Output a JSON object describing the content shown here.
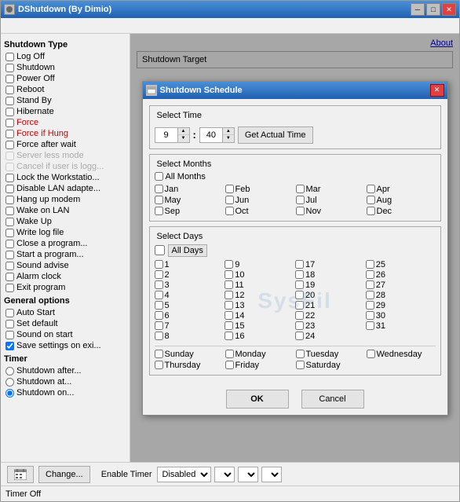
{
  "window": {
    "title": "DShutdown (By Dimio)",
    "icon": "app-icon",
    "minimize": "─",
    "maximize": "□",
    "close": "✕"
  },
  "menu": {
    "items": []
  },
  "left_panel": {
    "group_shutdown": "Shutdown Type",
    "items": [
      {
        "label": "Log Off",
        "checked": false,
        "disabled": false,
        "red": false
      },
      {
        "label": "Shutdown",
        "checked": false,
        "disabled": false,
        "red": false
      },
      {
        "label": "Power Off",
        "checked": false,
        "disabled": false,
        "red": false
      },
      {
        "label": "Reboot",
        "checked": false,
        "disabled": false,
        "red": false
      },
      {
        "label": "Stand By",
        "checked": false,
        "disabled": false,
        "red": false
      },
      {
        "label": "Hibernate",
        "checked": false,
        "disabled": false,
        "red": false
      },
      {
        "label": "Force",
        "checked": false,
        "disabled": false,
        "red": true
      },
      {
        "label": "Force if Hung",
        "checked": false,
        "disabled": false,
        "red": true
      },
      {
        "label": "Force after wait",
        "checked": false,
        "disabled": false,
        "red": false
      },
      {
        "label": "Server less mode",
        "checked": false,
        "disabled": true,
        "red": false
      },
      {
        "label": "Cancel if user is logg...",
        "checked": false,
        "disabled": true,
        "red": false
      },
      {
        "label": "Lock the Workstatio...",
        "checked": false,
        "disabled": false,
        "red": false
      },
      {
        "label": "Disable LAN adapte...",
        "checked": false,
        "disabled": false,
        "red": false
      },
      {
        "label": "Hang up modem",
        "checked": false,
        "disabled": false,
        "red": false
      },
      {
        "label": "Wake on LAN",
        "checked": false,
        "disabled": false,
        "red": false
      },
      {
        "label": "Wake Up",
        "checked": false,
        "disabled": false,
        "red": false
      },
      {
        "label": "Write log file",
        "checked": false,
        "disabled": false,
        "red": false
      },
      {
        "label": "Close a program...",
        "checked": false,
        "disabled": false,
        "red": false
      },
      {
        "label": "Start a program...",
        "checked": false,
        "disabled": false,
        "red": false
      },
      {
        "label": "Sound advise",
        "checked": false,
        "disabled": false,
        "red": false
      },
      {
        "label": "Alarm clock",
        "checked": false,
        "disabled": false,
        "red": false
      },
      {
        "label": "Exit program",
        "checked": false,
        "disabled": false,
        "red": false
      }
    ],
    "group_general": "General options",
    "general_items": [
      {
        "label": "Auto Start",
        "checked": false
      },
      {
        "label": "Set default",
        "checked": false
      },
      {
        "label": "Sound on start",
        "checked": false
      },
      {
        "label": "Save settings on exi...",
        "checked": true
      }
    ],
    "group_timer": "Timer",
    "timer_items": [
      {
        "label": "Shutdown after...",
        "value": "after"
      },
      {
        "label": "Shutdown at...",
        "value": "at"
      },
      {
        "label": "Shutdown on...",
        "value": "on",
        "selected": true
      }
    ]
  },
  "right_panel": {
    "about_label": "About",
    "shutdown_target": "Shutdown Target"
  },
  "bottom": {
    "calendar_btn": "📅",
    "change_btn": "Change...",
    "enable_timer": "Enable Timer",
    "dropdowns": [
      "Disabled",
      "",
      "",
      ""
    ],
    "status": "Timer Off"
  },
  "modal": {
    "title": "Shutdown Schedule",
    "icon": "schedule-icon",
    "close_btn": "✕",
    "select_time_label": "Select Time",
    "hour_value": "9",
    "minute_value": "40",
    "actual_time_btn": "Get Actual Time",
    "select_months_label": "Select Months",
    "all_months_label": "All Months",
    "all_months_checked": false,
    "months": [
      {
        "label": "Jan",
        "checked": false
      },
      {
        "label": "Feb",
        "checked": false
      },
      {
        "label": "Mar",
        "checked": false
      },
      {
        "label": "Apr",
        "checked": false
      },
      {
        "label": "May",
        "checked": false
      },
      {
        "label": "Jun",
        "checked": false
      },
      {
        "label": "Jul",
        "checked": false
      },
      {
        "label": "Aug",
        "checked": false
      },
      {
        "label": "Sep",
        "checked": false
      },
      {
        "label": "Oct",
        "checked": false
      },
      {
        "label": "Nov",
        "checked": false
      },
      {
        "label": "Dec",
        "checked": false
      }
    ],
    "select_days_label": "Select Days",
    "all_days_label": "All Days",
    "all_days_checked": false,
    "days": [
      "1",
      "2",
      "3",
      "4",
      "5",
      "6",
      "7",
      "8",
      "9",
      "10",
      "11",
      "12",
      "13",
      "14",
      "15",
      "16",
      "17",
      "18",
      "19",
      "20",
      "21",
      "22",
      "23",
      "24",
      "25",
      "26",
      "27",
      "28",
      "29",
      "30",
      "31"
    ],
    "weekdays": [
      {
        "label": "Sunday",
        "checked": false
      },
      {
        "label": "Monday",
        "checked": false
      },
      {
        "label": "Tuesday",
        "checked": false
      },
      {
        "label": "Wednesday",
        "checked": false
      },
      {
        "label": "Thursday",
        "checked": false
      },
      {
        "label": "Friday",
        "checked": false
      },
      {
        "label": "Saturday",
        "checked": false
      }
    ],
    "ok_label": "OK",
    "cancel_label": "Cancel"
  }
}
